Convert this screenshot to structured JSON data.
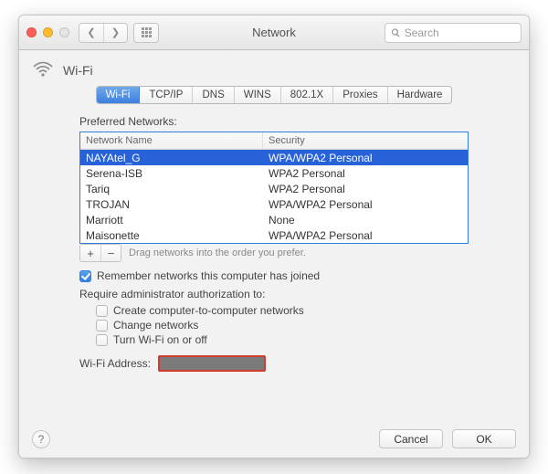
{
  "window": {
    "title": "Network"
  },
  "toolbar": {
    "search_placeholder": "Search"
  },
  "header": {
    "interface": "Wi-Fi"
  },
  "tabs": [
    {
      "label": "Wi-Fi",
      "active": true
    },
    {
      "label": "TCP/IP",
      "active": false
    },
    {
      "label": "DNS",
      "active": false
    },
    {
      "label": "WINS",
      "active": false
    },
    {
      "label": "802.1X",
      "active": false
    },
    {
      "label": "Proxies",
      "active": false
    },
    {
      "label": "Hardware",
      "active": false
    }
  ],
  "preferred": {
    "label": "Preferred Networks:",
    "columns": {
      "name": "Network Name",
      "security": "Security"
    },
    "rows": [
      {
        "name": "NAYAtel_G",
        "security": "WPA/WPA2 Personal",
        "selected": true
      },
      {
        "name": "Serena-ISB",
        "security": "WPA2 Personal",
        "selected": false
      },
      {
        "name": "Tariq",
        "security": "WPA2 Personal",
        "selected": false
      },
      {
        "name": "TROJAN",
        "security": "WPA/WPA2 Personal",
        "selected": false
      },
      {
        "name": "Marriott",
        "security": "None",
        "selected": false
      },
      {
        "name": "Maisonette",
        "security": "WPA/WPA2 Personal",
        "selected": false
      }
    ],
    "drag_hint": "Drag networks into the order you prefer."
  },
  "options": {
    "remember": {
      "label": "Remember networks this computer has joined",
      "checked": true
    },
    "require_label": "Require administrator authorization to:",
    "require": [
      {
        "label": "Create computer-to-computer networks",
        "checked": false
      },
      {
        "label": "Change networks",
        "checked": false
      },
      {
        "label": "Turn Wi-Fi on or off",
        "checked": false
      }
    ],
    "address_label": "Wi-Fi Address:"
  },
  "buttons": {
    "cancel": "Cancel",
    "ok": "OK"
  }
}
